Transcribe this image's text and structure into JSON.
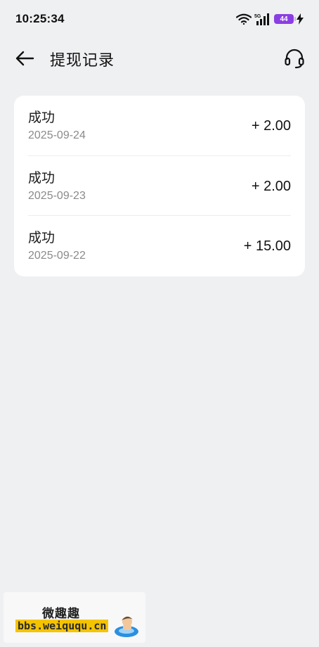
{
  "status_bar": {
    "time": "10:25:34",
    "network": "5G",
    "battery": "44",
    "icons": [
      "wifi-icon",
      "signal-icon",
      "battery-icon",
      "charging-icon"
    ]
  },
  "header": {
    "title": "提现记录",
    "back_icon": "back-arrow-icon",
    "support_icon": "headset-icon"
  },
  "records": [
    {
      "status": "成功",
      "date": "2025-09-24",
      "amount": "+ 2.00"
    },
    {
      "status": "成功",
      "date": "2025-09-23",
      "amount": "+ 2.00"
    },
    {
      "status": "成功",
      "date": "2025-09-22",
      "amount": "+ 15.00"
    }
  ],
  "watermark": {
    "title": "微趣趣",
    "url": "bbs.weiququ.cn"
  },
  "colors": {
    "background": "#eff0f2",
    "card": "#ffffff",
    "battery": "#8b3fe3",
    "watermark_highlight": "#f5c400"
  }
}
